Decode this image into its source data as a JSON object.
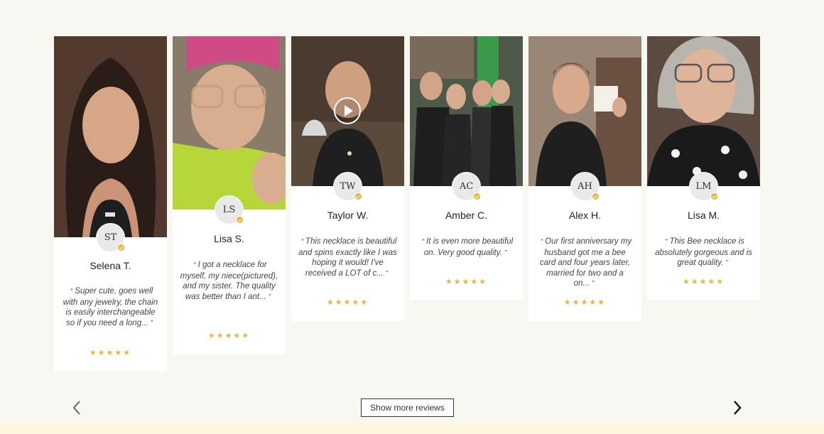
{
  "reviews": [
    {
      "initials": "ST",
      "name": "Selena T.",
      "text": "Super cute, goes well with any jewelry, the chain is easily interchangeable so if you need a long...",
      "stars": "★★★★★",
      "rating": 5,
      "photo": "selfie-woman-necklace",
      "video": false
    },
    {
      "initials": "LS",
      "name": "Lisa S.",
      "text": "I got a necklace for myself, my niece(pictured), and my sister. The quality was better than I ant...",
      "stars": "★★★★★",
      "rating": 5,
      "photo": "woman-holding-pendant",
      "video": false
    },
    {
      "initials": "TW",
      "name": "Taylor W.",
      "text": "This necklace is beautiful and spins exactly like I was hoping it would! I've received a LOT of c...",
      "stars": "★★★★★",
      "rating": 5,
      "photo": "woman-video-necklace",
      "video": true
    },
    {
      "initials": "AC",
      "name": "Amber C.",
      "text": "It is even more beautiful on. Very good quality.",
      "stars": "★★★★★",
      "rating": 5,
      "photo": "group-store-staff",
      "video": false
    },
    {
      "initials": "AH",
      "name": "Alex H.",
      "text": "Our first anniversary my husband got me a bee card and four years later, married for two and a on...",
      "stars": "★★★★★",
      "rating": 5,
      "photo": "woman-holding-card",
      "video": false
    },
    {
      "initials": "LM",
      "name": "Lisa M.",
      "text": "This Bee necklace is absolutely gorgeous and is great quality.",
      "stars": "★★★★★",
      "rating": 5,
      "photo": "smiling-woman-glasses",
      "video": false
    }
  ],
  "controls": {
    "show_more_label": "Show more reviews",
    "prev_icon": "chevron-left-icon",
    "next_icon": "chevron-right-icon",
    "quote_open": "“",
    "quote_close": "”"
  },
  "colors": {
    "background": "#f8f7f2",
    "card": "#ffffff",
    "star": "#f0b43a",
    "verified": "#f0b43a",
    "footer_band": "#fff4dc"
  }
}
